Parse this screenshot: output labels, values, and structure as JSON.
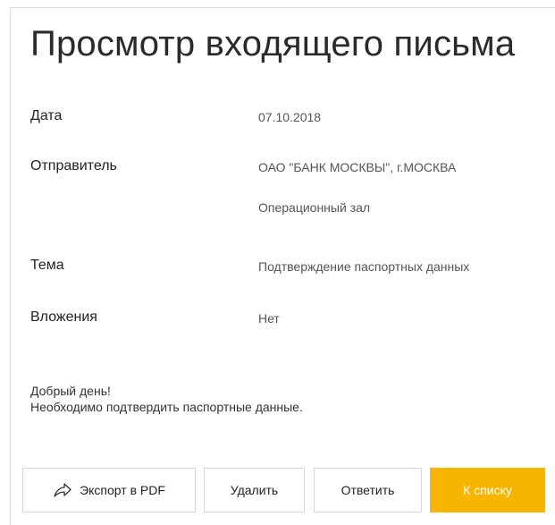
{
  "page": {
    "title": "Просмотр входящего письма"
  },
  "fields": {
    "date_label": "Дата",
    "date_value": "07.10.2018",
    "sender_label": "Отправитель",
    "sender_value_line1": "ОАО \"БАНК МОСКВЫ\", г.МОСКВА",
    "sender_value_line2": "Операционный зал",
    "subject_label": "Тема",
    "subject_value": "Подтверждение паспортных данных",
    "attachments_label": "Вложения",
    "attachments_value": "Нет"
  },
  "message": {
    "line1": "Добрый день!",
    "line2": "Необходимо подтвердить паспортные данные."
  },
  "actions": {
    "export_label": "Экспорт в PDF",
    "export_icon": "share-icon",
    "delete_label": "Удалить",
    "reply_label": "Ответить",
    "back_label": "К списку"
  },
  "colors": {
    "accent": "#f7b500",
    "border": "#d6d6d6"
  }
}
